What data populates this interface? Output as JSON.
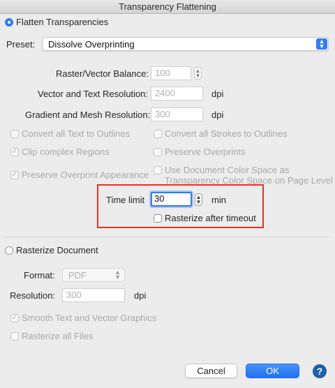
{
  "window": {
    "title": "Transparency Flattening"
  },
  "flatten": {
    "radio_label": "Flatten Transparencies",
    "selected": true,
    "preset_label": "Preset:",
    "preset_value": "Dissolve Overprinting",
    "raster_balance_label": "Raster/Vector Balance:",
    "raster_balance_value": "100",
    "vector_text_res_label": "Vector and Text Resolution:",
    "vector_text_res_value": "2400",
    "gradient_mesh_res_label": "Gradient and Mesh Resolution:",
    "gradient_mesh_res_value": "300",
    "dpi_unit": "dpi",
    "options": {
      "convert_text_outlines": {
        "label": "Convert all Text to Outlines",
        "checked": false
      },
      "convert_strokes_outlines": {
        "label": "Convert all Strokes to Outlines",
        "checked": false
      },
      "clip_complex_regions": {
        "label": "Clip complex Regions",
        "checked": true
      },
      "preserve_overprints": {
        "label": "Preserve Overprints",
        "checked": false
      },
      "preserve_overprint_appearance": {
        "label": "Preserve Overprint Appearance",
        "checked": true
      },
      "use_doc_color_space": {
        "label_line1": "Use Document Color Space as",
        "label_line2": "Transparency Color Space on Page Level",
        "checked": false
      }
    },
    "time_limit_label": "Time limit",
    "time_limit_value": "30",
    "time_limit_unit": "min",
    "rasterize_after_timeout": {
      "label": "Rasterize after timeout",
      "checked": false
    }
  },
  "rasterize": {
    "radio_label": "Rasterize Document",
    "selected": false,
    "format_label": "Format:",
    "format_value": "PDF",
    "resolution_label": "Resolution:",
    "resolution_value": "300",
    "dpi_unit": "dpi",
    "smooth_text": {
      "label": "Smooth Text and Vector Graphics",
      "checked": true
    },
    "rasterize_all_files": {
      "label": "Rasterize all Files",
      "checked": false
    }
  },
  "buttons": {
    "cancel": "Cancel",
    "ok": "OK",
    "help": "?"
  },
  "colors": {
    "accent": "#2f7cf6",
    "highlight": "#e8321f",
    "help": "#1d5fa8"
  }
}
